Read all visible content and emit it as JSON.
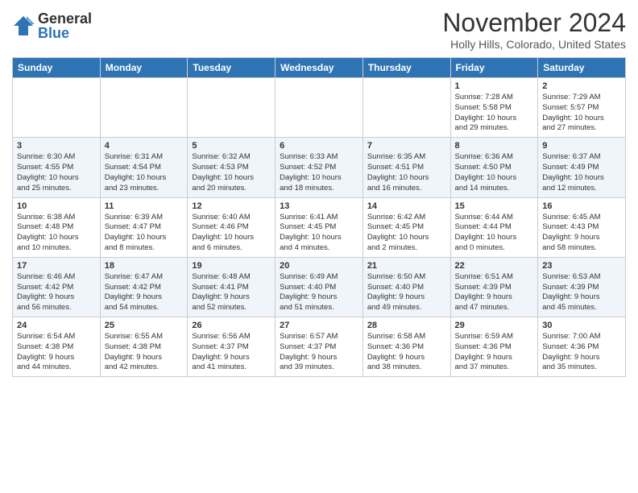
{
  "header": {
    "logo_general": "General",
    "logo_blue": "Blue",
    "month_title": "November 2024",
    "subtitle": "Holly Hills, Colorado, United States"
  },
  "weekdays": [
    "Sunday",
    "Monday",
    "Tuesday",
    "Wednesday",
    "Thursday",
    "Friday",
    "Saturday"
  ],
  "weeks": [
    [
      {
        "day": "",
        "info": ""
      },
      {
        "day": "",
        "info": ""
      },
      {
        "day": "",
        "info": ""
      },
      {
        "day": "",
        "info": ""
      },
      {
        "day": "",
        "info": ""
      },
      {
        "day": "1",
        "info": "Sunrise: 7:28 AM\nSunset: 5:58 PM\nDaylight: 10 hours\nand 29 minutes."
      },
      {
        "day": "2",
        "info": "Sunrise: 7:29 AM\nSunset: 5:57 PM\nDaylight: 10 hours\nand 27 minutes."
      }
    ],
    [
      {
        "day": "3",
        "info": "Sunrise: 6:30 AM\nSunset: 4:55 PM\nDaylight: 10 hours\nand 25 minutes."
      },
      {
        "day": "4",
        "info": "Sunrise: 6:31 AM\nSunset: 4:54 PM\nDaylight: 10 hours\nand 23 minutes."
      },
      {
        "day": "5",
        "info": "Sunrise: 6:32 AM\nSunset: 4:53 PM\nDaylight: 10 hours\nand 20 minutes."
      },
      {
        "day": "6",
        "info": "Sunrise: 6:33 AM\nSunset: 4:52 PM\nDaylight: 10 hours\nand 18 minutes."
      },
      {
        "day": "7",
        "info": "Sunrise: 6:35 AM\nSunset: 4:51 PM\nDaylight: 10 hours\nand 16 minutes."
      },
      {
        "day": "8",
        "info": "Sunrise: 6:36 AM\nSunset: 4:50 PM\nDaylight: 10 hours\nand 14 minutes."
      },
      {
        "day": "9",
        "info": "Sunrise: 6:37 AM\nSunset: 4:49 PM\nDaylight: 10 hours\nand 12 minutes."
      }
    ],
    [
      {
        "day": "10",
        "info": "Sunrise: 6:38 AM\nSunset: 4:48 PM\nDaylight: 10 hours\nand 10 minutes."
      },
      {
        "day": "11",
        "info": "Sunrise: 6:39 AM\nSunset: 4:47 PM\nDaylight: 10 hours\nand 8 minutes."
      },
      {
        "day": "12",
        "info": "Sunrise: 6:40 AM\nSunset: 4:46 PM\nDaylight: 10 hours\nand 6 minutes."
      },
      {
        "day": "13",
        "info": "Sunrise: 6:41 AM\nSunset: 4:45 PM\nDaylight: 10 hours\nand 4 minutes."
      },
      {
        "day": "14",
        "info": "Sunrise: 6:42 AM\nSunset: 4:45 PM\nDaylight: 10 hours\nand 2 minutes."
      },
      {
        "day": "15",
        "info": "Sunrise: 6:44 AM\nSunset: 4:44 PM\nDaylight: 10 hours\nand 0 minutes."
      },
      {
        "day": "16",
        "info": "Sunrise: 6:45 AM\nSunset: 4:43 PM\nDaylight: 9 hours\nand 58 minutes."
      }
    ],
    [
      {
        "day": "17",
        "info": "Sunrise: 6:46 AM\nSunset: 4:42 PM\nDaylight: 9 hours\nand 56 minutes."
      },
      {
        "day": "18",
        "info": "Sunrise: 6:47 AM\nSunset: 4:42 PM\nDaylight: 9 hours\nand 54 minutes."
      },
      {
        "day": "19",
        "info": "Sunrise: 6:48 AM\nSunset: 4:41 PM\nDaylight: 9 hours\nand 52 minutes."
      },
      {
        "day": "20",
        "info": "Sunrise: 6:49 AM\nSunset: 4:40 PM\nDaylight: 9 hours\nand 51 minutes."
      },
      {
        "day": "21",
        "info": "Sunrise: 6:50 AM\nSunset: 4:40 PM\nDaylight: 9 hours\nand 49 minutes."
      },
      {
        "day": "22",
        "info": "Sunrise: 6:51 AM\nSunset: 4:39 PM\nDaylight: 9 hours\nand 47 minutes."
      },
      {
        "day": "23",
        "info": "Sunrise: 6:53 AM\nSunset: 4:39 PM\nDaylight: 9 hours\nand 45 minutes."
      }
    ],
    [
      {
        "day": "24",
        "info": "Sunrise: 6:54 AM\nSunset: 4:38 PM\nDaylight: 9 hours\nand 44 minutes."
      },
      {
        "day": "25",
        "info": "Sunrise: 6:55 AM\nSunset: 4:38 PM\nDaylight: 9 hours\nand 42 minutes."
      },
      {
        "day": "26",
        "info": "Sunrise: 6:56 AM\nSunset: 4:37 PM\nDaylight: 9 hours\nand 41 minutes."
      },
      {
        "day": "27",
        "info": "Sunrise: 6:57 AM\nSunset: 4:37 PM\nDaylight: 9 hours\nand 39 minutes."
      },
      {
        "day": "28",
        "info": "Sunrise: 6:58 AM\nSunset: 4:36 PM\nDaylight: 9 hours\nand 38 minutes."
      },
      {
        "day": "29",
        "info": "Sunrise: 6:59 AM\nSunset: 4:36 PM\nDaylight: 9 hours\nand 37 minutes."
      },
      {
        "day": "30",
        "info": "Sunrise: 7:00 AM\nSunset: 4:36 PM\nDaylight: 9 hours\nand 35 minutes."
      }
    ]
  ]
}
